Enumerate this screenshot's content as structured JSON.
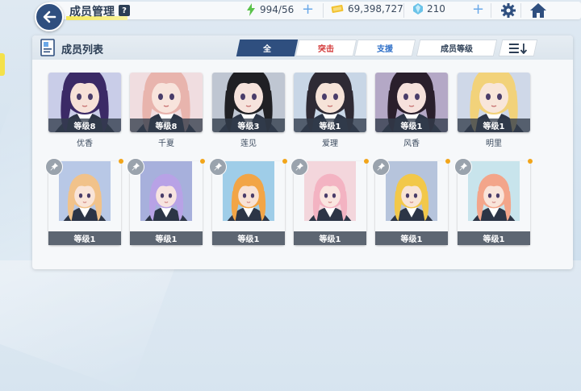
{
  "header": {
    "title": "成员管理",
    "help_label": "?",
    "stamina": "994/56",
    "credits": "69,398,727",
    "gems": "210"
  },
  "panel": {
    "title": "成员列表",
    "tabs": [
      {
        "label": "全",
        "active": true
      },
      {
        "label": "突击",
        "active": false
      },
      {
        "label": "支援",
        "active": false
      }
    ],
    "sort_label": "成员等级"
  },
  "members": [
    {
      "level": "等级8",
      "name": "优香",
      "hair": "#3b2a66",
      "bg": "#c9cde8",
      "skin": "#f6e1d8"
    },
    {
      "level": "等级8",
      "name": "千夏",
      "hair": "#e8b4ad",
      "bg": "#f0dde0",
      "skin": "#f8e4dc"
    },
    {
      "level": "等级3",
      "name": "莲见",
      "hair": "#202024",
      "bg": "#bfc6d2",
      "skin": "#f6e3dc"
    },
    {
      "level": "等级1",
      "name": "爱理",
      "hair": "#2e2a34",
      "bg": "#c8d6e6",
      "skin": "#f6e3d8"
    },
    {
      "level": "等级1",
      "name": "风香",
      "hair": "#2a1f2c",
      "bg": "#b4a8c6",
      "skin": "#f6e1dc"
    },
    {
      "level": "等级1",
      "name": "明里",
      "hair": "#f2d27a",
      "bg": "#cfd8e8",
      "skin": "#f8e6da"
    },
    {
      "level": "等级1",
      "name": "",
      "hair": "#f1c28a",
      "bg": "#b8c8e6",
      "skin": "#f9e4d8"
    },
    {
      "level": "等级1",
      "name": "",
      "hair": "#b8a2e6",
      "bg": "#a7b0dc",
      "skin": "#f7e4e0"
    },
    {
      "level": "等级1",
      "name": "",
      "hair": "#f2a546",
      "bg": "#9fcde8",
      "skin": "#f8e2d4"
    },
    {
      "level": "等级1",
      "name": "",
      "hair": "#f3b3c2",
      "bg": "#f3d6dc",
      "skin": "#fae6e0"
    },
    {
      "level": "等级1",
      "name": "",
      "hair": "#f2c84a",
      "bg": "#b6c4dc",
      "skin": "#f8e4d6"
    },
    {
      "level": "等级1",
      "name": "",
      "hair": "#f3a58a",
      "bg": "#c8e4ec",
      "skin": "#f9e4da"
    }
  ],
  "colors": {
    "accent": "#2f4f7f",
    "highlight": "#f5e95a",
    "strike_tab": "#d43a3a",
    "support_tab": "#2f70c8",
    "plus": "#6aa8e8"
  },
  "icons": [
    "back-icon",
    "help-icon",
    "stamina-icon",
    "credit-icon",
    "gem-icon",
    "plus-icon",
    "gear-icon",
    "home-icon",
    "member-list-icon",
    "sort-order-icon",
    "favorite-pin-icon"
  ]
}
